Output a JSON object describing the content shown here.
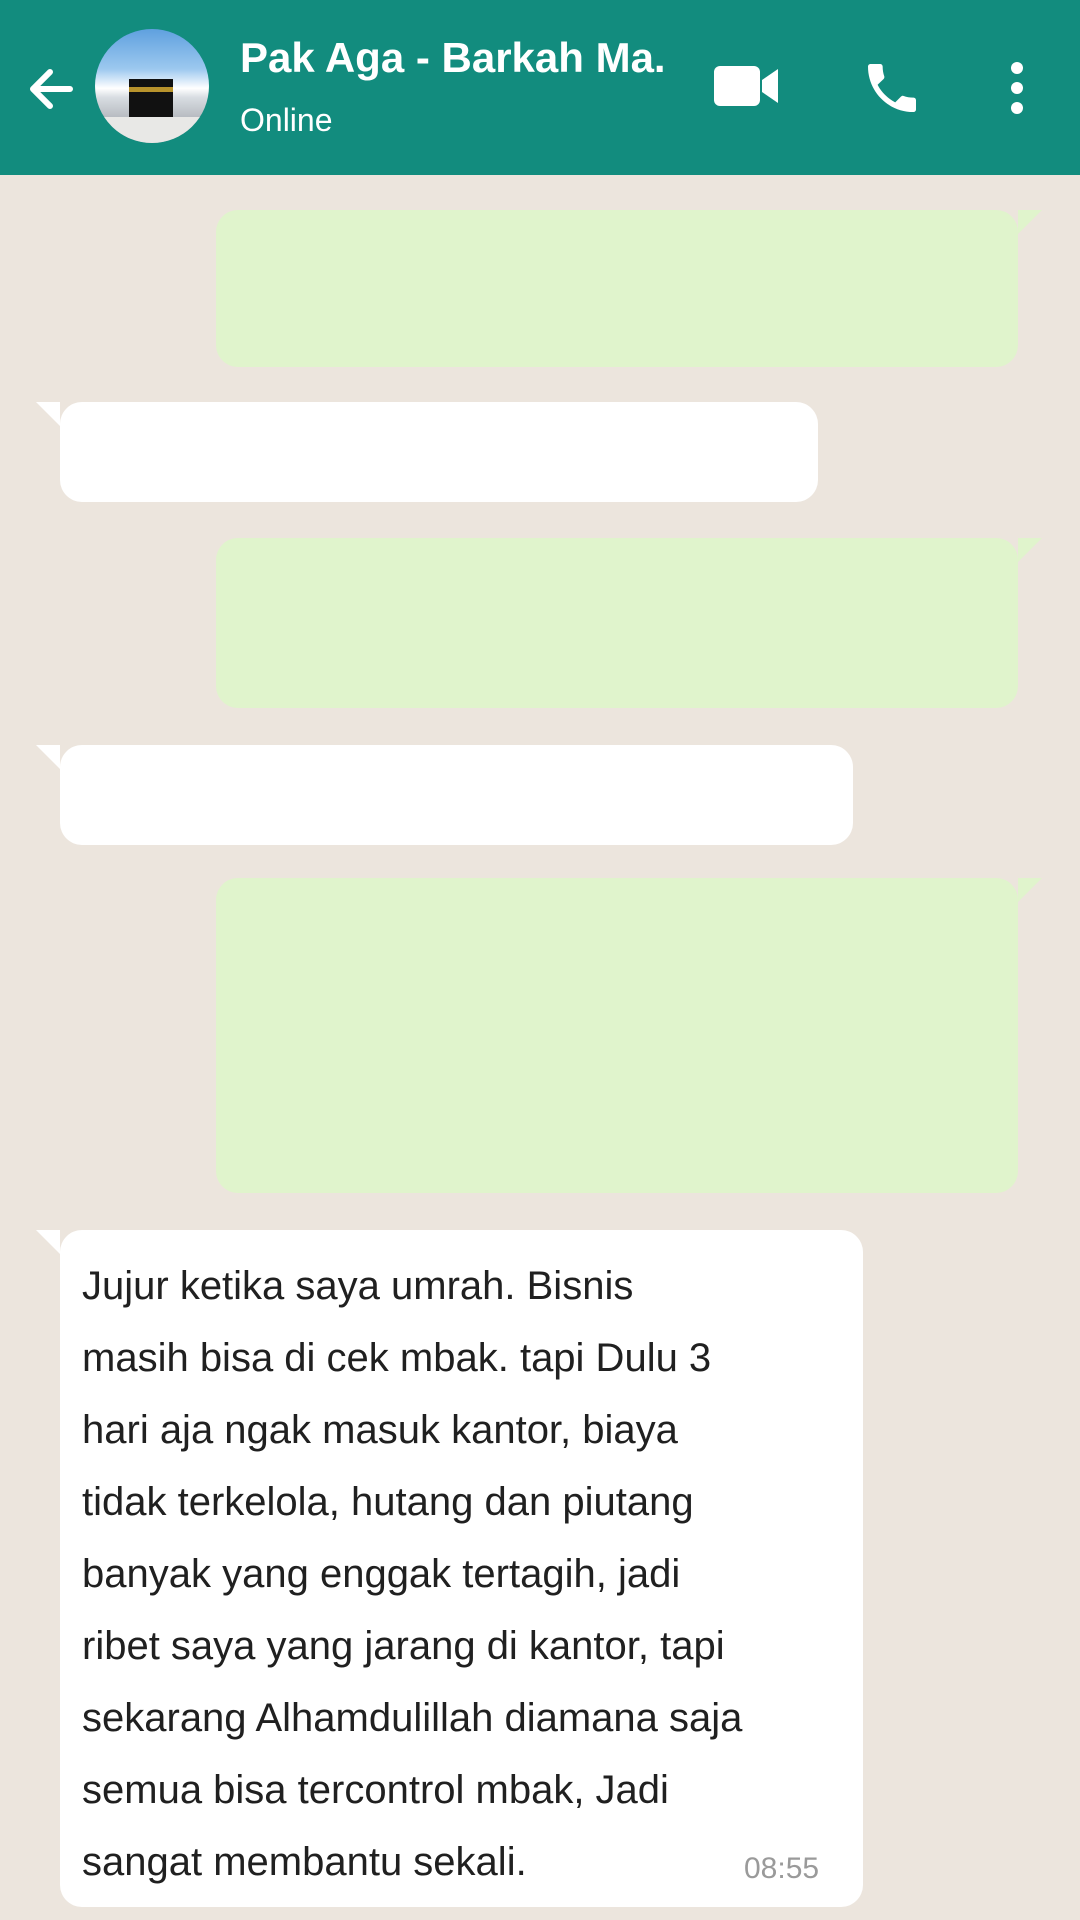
{
  "header": {
    "contact_name": "Pak Aga - Barkah Ma.",
    "status": "Online",
    "icons": {
      "back": "arrow-left-icon",
      "video": "video-camera-icon",
      "call": "phone-icon",
      "menu": "more-vertical-icon"
    },
    "accent_color": "#128c7e"
  },
  "chat": {
    "background_color": "#ece5dd",
    "outgoing_color": "#dcf8c6",
    "incoming_color": "#ffffff",
    "last_message": {
      "text": " Jujur ketika saya umrah. Bisnis\nmasih bisa di cek mbak. tapi Dulu 3\nhari aja ngak masuk kantor, biaya\ntidak terkelola, hutang dan piutang\nbanyak yang enggak tertagih, jadi\nribet saya yang jarang di kantor, tapi\nsekarang Alhamdulillah diamana saja\nsemua bisa tercontrol mbak, Jadi\nsangat membantu sekali.",
      "time": "08:55"
    }
  }
}
